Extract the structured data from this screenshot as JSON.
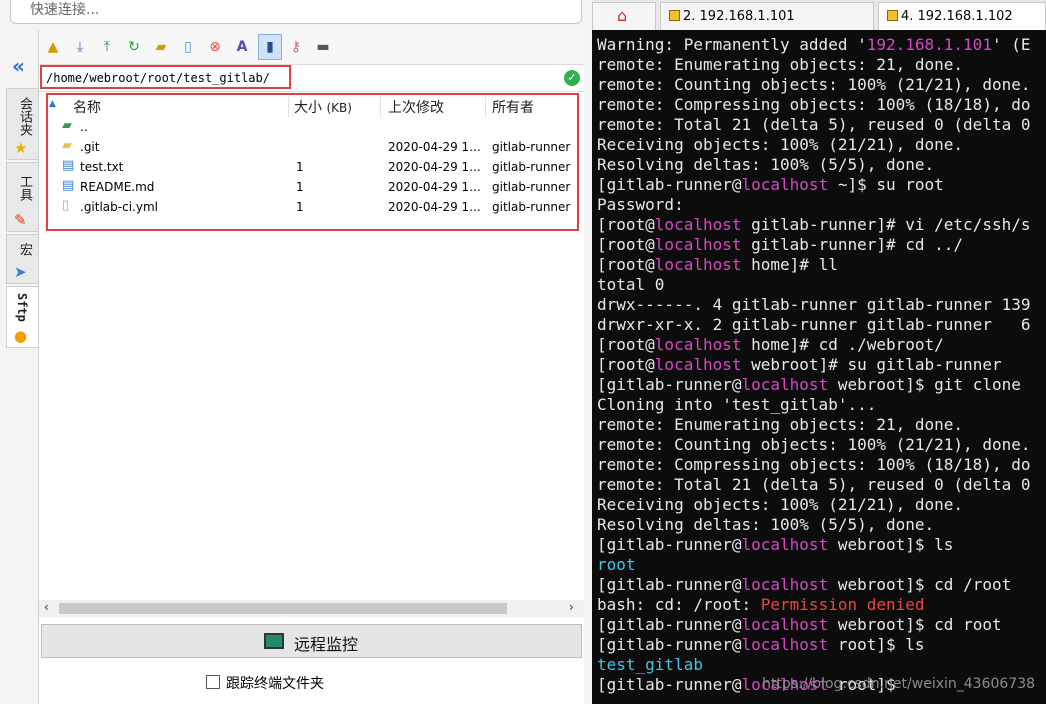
{
  "sftp": {
    "quick_connect_placeholder": "快速连接...",
    "side_tabs": [
      "会话夹",
      "工具",
      "宏",
      "Sftp"
    ],
    "current_path": "/home/webroot/root/test_gitlab/",
    "columns": {
      "name": "名称",
      "size": "大小",
      "size_unit": "(KB)",
      "modified": "上次修改",
      "owner": "所有者"
    },
    "files": [
      {
        "name": "..",
        "size": "",
        "modified": "",
        "owner": ""
      },
      {
        "name": ".git",
        "size": "",
        "modified": "2020-04-29 1...",
        "owner": "gitlab-runner"
      },
      {
        "name": "test.txt",
        "size": "1",
        "modified": "2020-04-29 1...",
        "owner": "gitlab-runner"
      },
      {
        "name": "README.md",
        "size": "1",
        "modified": "2020-04-29 1...",
        "owner": "gitlab-runner"
      },
      {
        "name": ".gitlab-ci.yml",
        "size": "1",
        "modified": "2020-04-29 1...",
        "owner": "gitlab-runner"
      }
    ],
    "remote_monitor_label": "远程监控",
    "follow_terminal_label": "跟踪终端文件夹"
  },
  "terminal": {
    "tabs": [
      {
        "label": "2. 192.168.1.101"
      },
      {
        "label": "4. 192.168.1.102"
      }
    ],
    "lines": [
      [
        {
          "t": "Warning: Permanently added '"
        },
        {
          "t": "192.168.1.101",
          "c": "mag"
        },
        {
          "t": "' (E"
        }
      ],
      [
        {
          "t": "remote: Enumerating objects: 21, done."
        }
      ],
      [
        {
          "t": "remote: Counting objects: 100% (21/21), done."
        }
      ],
      [
        {
          "t": "remote: Compressing objects: 100% (18/18), do"
        }
      ],
      [
        {
          "t": "remote: Total 21 (delta 5), reused 0 (delta 0"
        }
      ],
      [
        {
          "t": "Receiving objects: 100% (21/21), done."
        }
      ],
      [
        {
          "t": "Resolving deltas: 100% (5/5), done."
        }
      ],
      [
        {
          "t": "[gitlab-runner@"
        },
        {
          "t": "localhost",
          "c": "mag"
        },
        {
          "t": " ~]$ su root"
        }
      ],
      [
        {
          "t": "Password:"
        }
      ],
      [
        {
          "t": "[root@"
        },
        {
          "t": "localhost",
          "c": "mag"
        },
        {
          "t": " gitlab-runner]# vi /etc/ssh/s"
        }
      ],
      [
        {
          "t": "[root@"
        },
        {
          "t": "localhost",
          "c": "mag"
        },
        {
          "t": " gitlab-runner]# cd ../"
        }
      ],
      [
        {
          "t": "[root@"
        },
        {
          "t": "localhost",
          "c": "mag"
        },
        {
          "t": " home]# ll"
        }
      ],
      [
        {
          "t": "total 0"
        }
      ],
      [
        {
          "t": "drwx------. 4 gitlab-runner gitlab-runner 139"
        }
      ],
      [
        {
          "t": "drwxr-xr-x. 2 gitlab-runner gitlab-runner   6"
        }
      ],
      [
        {
          "t": "[root@"
        },
        {
          "t": "localhost",
          "c": "mag"
        },
        {
          "t": " home]# cd ./webroot/"
        }
      ],
      [
        {
          "t": "[root@"
        },
        {
          "t": "localhost",
          "c": "mag"
        },
        {
          "t": " webroot]# su gitlab-runner"
        }
      ],
      [
        {
          "t": "[gitlab-runner@"
        },
        {
          "t": "localhost",
          "c": "mag"
        },
        {
          "t": " webroot]$ git clone"
        }
      ],
      [
        {
          "t": "Cloning into 'test_gitlab'..."
        }
      ],
      [
        {
          "t": "remote: Enumerating objects: 21, done."
        }
      ],
      [
        {
          "t": "remote: Counting objects: 100% (21/21), done."
        }
      ],
      [
        {
          "t": "remote: Compressing objects: 100% (18/18), do"
        }
      ],
      [
        {
          "t": "remote: Total 21 (delta 5), reused 0 (delta 0"
        }
      ],
      [
        {
          "t": "Receiving objects: 100% (21/21), done."
        }
      ],
      [
        {
          "t": "Resolving deltas: 100% (5/5), done."
        }
      ],
      [
        {
          "t": "[gitlab-runner@"
        },
        {
          "t": "localhost",
          "c": "mag"
        },
        {
          "t": " webroot]$ ls"
        }
      ],
      [
        {
          "t": "root",
          "c": "cyan"
        }
      ],
      [
        {
          "t": "[gitlab-runner@"
        },
        {
          "t": "localhost",
          "c": "mag"
        },
        {
          "t": " webroot]$ cd /root"
        }
      ],
      [
        {
          "t": "bash: cd: /root: "
        },
        {
          "t": "Permission denied",
          "c": "red"
        }
      ],
      [
        {
          "t": "[gitlab-runner@"
        },
        {
          "t": "localhost",
          "c": "mag"
        },
        {
          "t": " webroot]$ cd root"
        }
      ],
      [
        {
          "t": "[gitlab-runner@"
        },
        {
          "t": "localhost",
          "c": "mag"
        },
        {
          "t": " root]$ ls"
        }
      ],
      [
        {
          "t": "test_gitlab",
          "c": "cyan"
        }
      ],
      [
        {
          "t": "[gitlab-runner@"
        },
        {
          "t": "localhost",
          "c": "mag"
        },
        {
          "t": " root]$ "
        }
      ]
    ],
    "watermark": "https://blog.csdn.net/weixin_43606738"
  }
}
